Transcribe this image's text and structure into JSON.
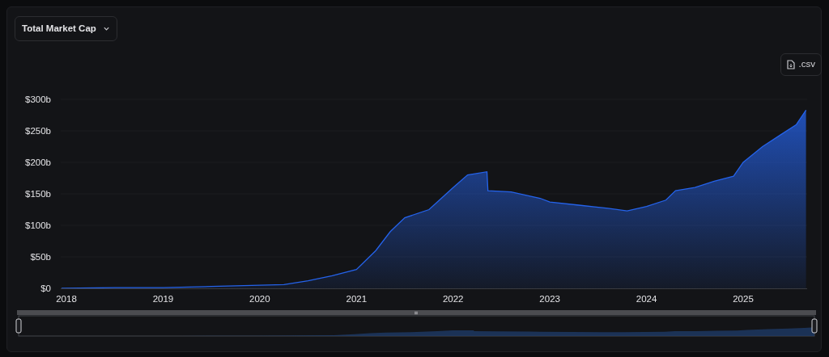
{
  "metric_selector": {
    "label": "Total Market Cap"
  },
  "export_button": {
    "label": ".csv"
  },
  "chart_data": {
    "type": "area",
    "xlim": [
      2017.95,
      2025.65
    ],
    "ylim": [
      0,
      300
    ],
    "xticks": [
      {
        "value": 2018,
        "label": "2018"
      },
      {
        "value": 2019,
        "label": "2019"
      },
      {
        "value": 2020,
        "label": "2020"
      },
      {
        "value": 2021,
        "label": "2021"
      },
      {
        "value": 2022,
        "label": "2022"
      },
      {
        "value": 2023,
        "label": "2023"
      },
      {
        "value": 2024,
        "label": "2024"
      },
      {
        "value": 2025,
        "label": "2025"
      }
    ],
    "yticks": [
      {
        "value": 0,
        "label": "$0"
      },
      {
        "value": 50,
        "label": "$50b"
      },
      {
        "value": 100,
        "label": "$100b"
      },
      {
        "value": 150,
        "label": "$150b"
      },
      {
        "value": 200,
        "label": "$200b"
      },
      {
        "value": 250,
        "label": "$250b"
      },
      {
        "value": 300,
        "label": "$300b"
      }
    ],
    "x": [
      2017.95,
      2018.5,
      2019.0,
      2019.5,
      2020.0,
      2020.25,
      2020.5,
      2020.75,
      2021.0,
      2021.2,
      2021.35,
      2021.5,
      2021.75,
      2022.0,
      2022.15,
      2022.35,
      2022.36,
      2022.6,
      2022.9,
      2023.0,
      2023.3,
      2023.6,
      2023.8,
      2024.0,
      2024.2,
      2024.3,
      2024.5,
      2024.7,
      2024.9,
      2025.0,
      2025.2,
      2025.4,
      2025.55,
      2025.65
    ],
    "series": [
      {
        "color": "#2563eb",
        "values": [
          0,
          1,
          1,
          3,
          5,
          6,
          12,
          20,
          30,
          60,
          90,
          112,
          125,
          160,
          180,
          185,
          155,
          153,
          143,
          137,
          132,
          127,
          123,
          130,
          140,
          155,
          160,
          170,
          178,
          200,
          225,
          245,
          260,
          283
        ]
      }
    ]
  }
}
